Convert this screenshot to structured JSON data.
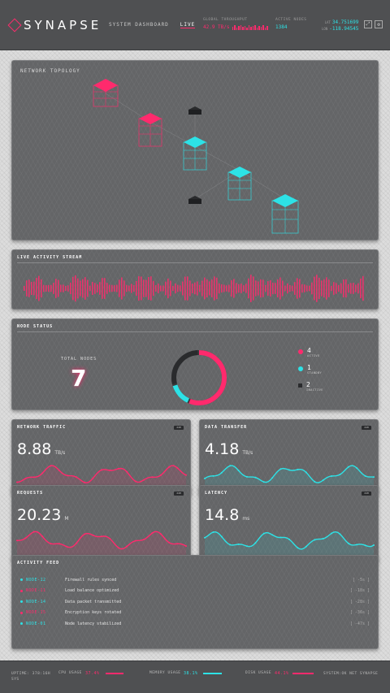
{
  "header": {
    "brand": "SYNAPSE",
    "nav": [
      "SYSTEM DASHBOARD",
      "LIVE"
    ],
    "throughput": {
      "label": "GLOBAL THROUGHPUT",
      "value": "42.9 TB/s"
    },
    "active": {
      "label": "ACTIVE NODES",
      "value": "1384"
    },
    "coords": {
      "lat_label": "LAT",
      "lat": "34.751699",
      "lon_label": "LON",
      "lon": "-118.94545"
    },
    "icons": [
      "expand-icon",
      "settings-icon"
    ]
  },
  "topology": {
    "title": "NETWORK TOPOLOGY"
  },
  "activity_stream": {
    "title": "LIVE ACTIVITY STREAM"
  },
  "node_status": {
    "title": "NODE STATUS",
    "total_label": "TOTAL NODES",
    "total": "7",
    "active": {
      "count": "4",
      "label": "ACTIVE",
      "fraction": 0.57
    },
    "standby": {
      "count": "1",
      "label": "STANDBY",
      "fraction": 0.14
    },
    "inactive": {
      "count": "2",
      "label": "INACTIVE",
      "fraction": 0.29
    }
  },
  "metrics": {
    "traffic": {
      "title": "NETWORK TRAFFIC",
      "value": "8.88",
      "unit": "TB/s",
      "toggle": "24H"
    },
    "transfer": {
      "title": "DATA TRANSFER",
      "value": "4.18",
      "unit": "TB/s",
      "toggle": "24H"
    },
    "requests": {
      "title": "REQUESTS",
      "value": "20.23",
      "unit": "M",
      "toggle": "24H"
    },
    "latency": {
      "title": "LATENCY",
      "value": "14.8",
      "unit": "ms",
      "toggle": "24H"
    }
  },
  "feed": {
    "title": "ACTIVITY FEED",
    "rows": [
      {
        "node": "NODE-12",
        "msg": "Firewall rules synced",
        "time": "[ -5s ]",
        "color": "#2de2e6"
      },
      {
        "node": "NODE-11",
        "msg": "Load balance optimized",
        "time": "[ -18s ]",
        "color": "#ff2a6d"
      },
      {
        "node": "NODE-14",
        "msg": "Data packet transmitted",
        "time": "[ -28s ]",
        "color": "#2de2e6"
      },
      {
        "node": "NODE-15",
        "msg": "Encryption keys rotated",
        "time": "[ -36s ]",
        "color": "#ff2a6d"
      },
      {
        "node": "NODE-01",
        "msg": "Node latency stabilized",
        "time": "[ -47s ]",
        "color": "#2de2e6"
      }
    ]
  },
  "footer": {
    "status": "UPTIME: 378:16H  SYS",
    "cpu": {
      "label": "CPU USAGE",
      "value": "37.4%",
      "fill": 0.374
    },
    "memory": {
      "label": "MEMORY USAGE",
      "value": "38.1%",
      "fill": 0.381
    },
    "disk": {
      "label": "DISK USAGE",
      "value": "44.1%",
      "fill": 0.441
    },
    "system": "SYSTEM:OK  NET  SYNAPSE"
  },
  "colors": {
    "accent": "#ff2a6d",
    "secondary": "#2de2e6",
    "panel": "#646567"
  }
}
